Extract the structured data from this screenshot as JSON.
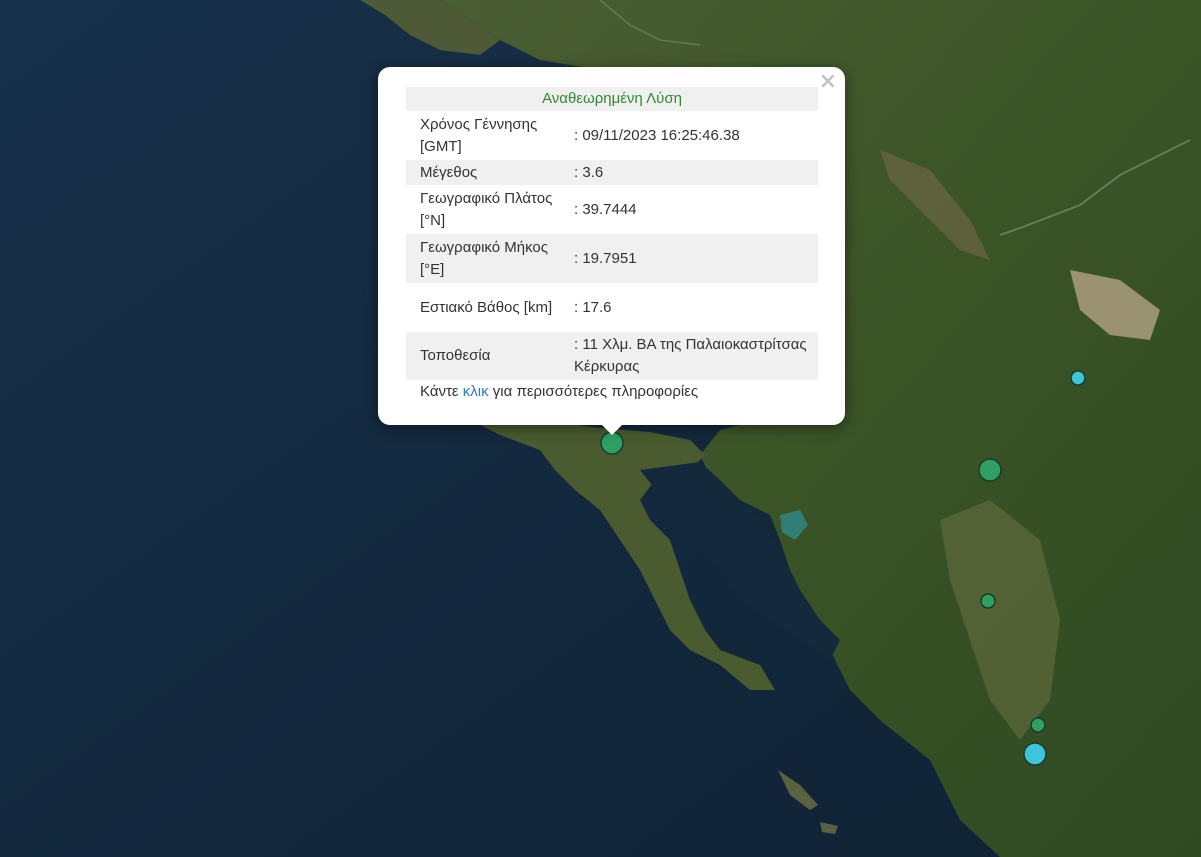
{
  "map": {
    "colors": {
      "sea": "#152b3d",
      "sea_deep": "#112434",
      "land": "#3f5a2c",
      "land_dark": "#2d4720",
      "land_light": "#6e6a48",
      "rock": "#b9a88a",
      "lagoon": "#2f8a8c"
    },
    "markers": [
      {
        "id": "quake-selected",
        "color": "#2fa064",
        "size": "large",
        "selected": true
      },
      {
        "id": "quake-1",
        "color": "#3bc7d8",
        "size": "small"
      },
      {
        "id": "quake-2",
        "color": "#2fa064",
        "size": "large"
      },
      {
        "id": "quake-3",
        "color": "#2fa064",
        "size": "small"
      },
      {
        "id": "quake-4",
        "color": "#2fa064",
        "size": "small"
      },
      {
        "id": "quake-5",
        "color": "#3bc7d8",
        "size": "large"
      }
    ]
  },
  "popup": {
    "close_icon": "×",
    "title": "Αναθεωρημένη Λύση",
    "rows": [
      {
        "label": "Χρόνος Γέννησης [GMT]",
        "value": ": 09/11/2023 16:25:46.38"
      },
      {
        "label": "Μέγεθος",
        "value": ": 3.6"
      },
      {
        "label": "Γεωγραφικό Πλάτος [°N]",
        "value": ": 39.7444"
      },
      {
        "label": "Γεωγραφικό Μήκος [°E]",
        "value": ": 19.7951"
      },
      {
        "label": "Εστιακό Βάθος [km]",
        "value": ": 17.6"
      },
      {
        "label": "Τοποθεσία",
        "value": ": 11 Χλμ. ΒΑ της Παλαιοκαστρίτσας Κέρκυρας"
      }
    ],
    "more_prefix": "Κάντε ",
    "more_link": "κλικ",
    "more_suffix": " για περισσότερες πληροφορίες"
  }
}
